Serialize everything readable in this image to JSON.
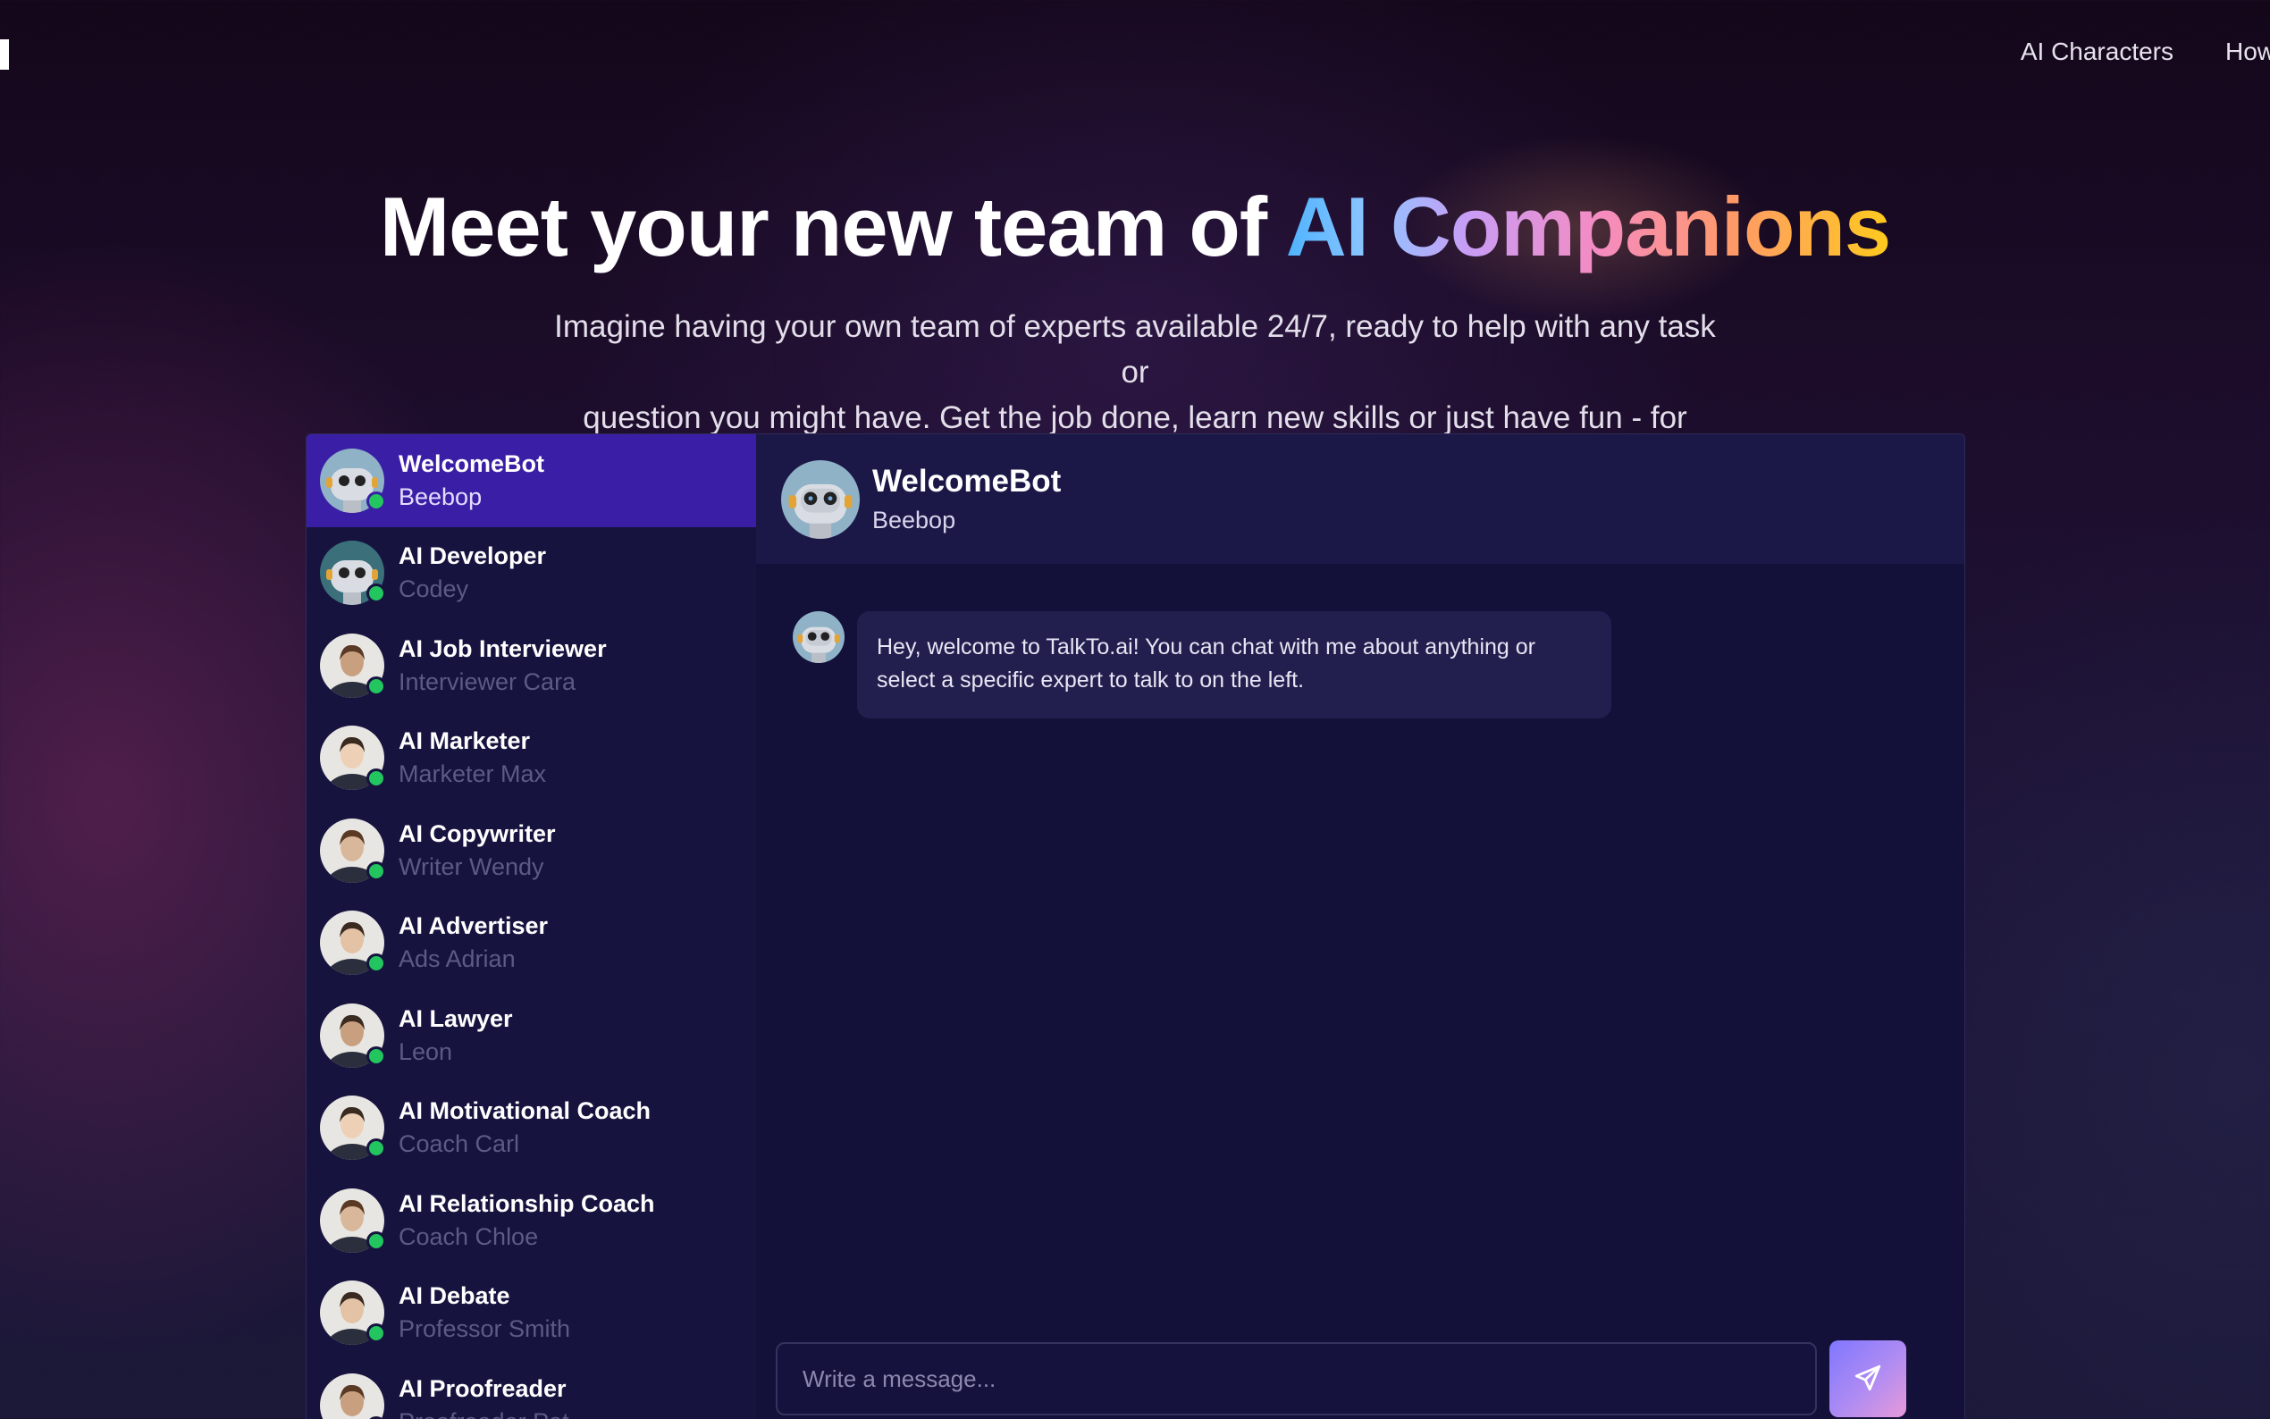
{
  "nav": {
    "links": [
      {
        "label": "AI Characters"
      },
      {
        "label": "How"
      }
    ]
  },
  "hero": {
    "title_plain": "Meet your new team of ",
    "title_ai": "AI",
    "title_space": " ",
    "title_companions": "Companions",
    "subtitle_line1": "Imagine having your own team of experts available 24/7, ready to help with any task or",
    "subtitle_line2": "question you might have. Get the job done, learn new skills or just have fun - for free."
  },
  "characters": [
    {
      "title": "WelcomeBot",
      "name": "Beebop",
      "active": true,
      "avatar": "robot-avatar-icon"
    },
    {
      "title": "AI Developer",
      "name": "Codey",
      "avatar": "robot-developer-avatar-icon"
    },
    {
      "title": "AI Job Interviewer",
      "name": "Interviewer Cara",
      "avatar": "woman-avatar-icon"
    },
    {
      "title": "AI Marketer",
      "name": "Marketer Max",
      "avatar": "man-avatar-icon"
    },
    {
      "title": "AI Copywriter",
      "name": "Writer Wendy",
      "avatar": "woman-avatar-icon"
    },
    {
      "title": "AI Advertiser",
      "name": "Ads Adrian",
      "avatar": "man-avatar-icon"
    },
    {
      "title": "AI Lawyer",
      "name": "Leon",
      "avatar": "man-avatar-icon"
    },
    {
      "title": "AI Motivational Coach",
      "name": "Coach Carl",
      "avatar": "man-avatar-icon"
    },
    {
      "title": "AI Relationship Coach",
      "name": "Coach Chloe",
      "avatar": "woman-avatar-icon"
    },
    {
      "title": "AI Debate",
      "name": "Professor Smith",
      "avatar": "man-avatar-icon"
    },
    {
      "title": "AI Proofreader",
      "name": "Proofreader Pat",
      "avatar": "woman-avatar-icon"
    }
  ],
  "chat": {
    "header_title": "WelcomeBot",
    "header_subtitle": "Beebop",
    "messages": [
      {
        "line1": "Hey, welcome to TalkTo.ai! You can chat with me about anything or",
        "line2": "select a specific expert to talk to on the left."
      }
    ],
    "input_placeholder": "Write a message...",
    "send_icon": "send-icon"
  },
  "colors": {
    "accent_active": "#3a1fa6",
    "online": "#22c55e",
    "send_button_from": "#7f77ff",
    "send_button_to": "#e79ad9"
  }
}
